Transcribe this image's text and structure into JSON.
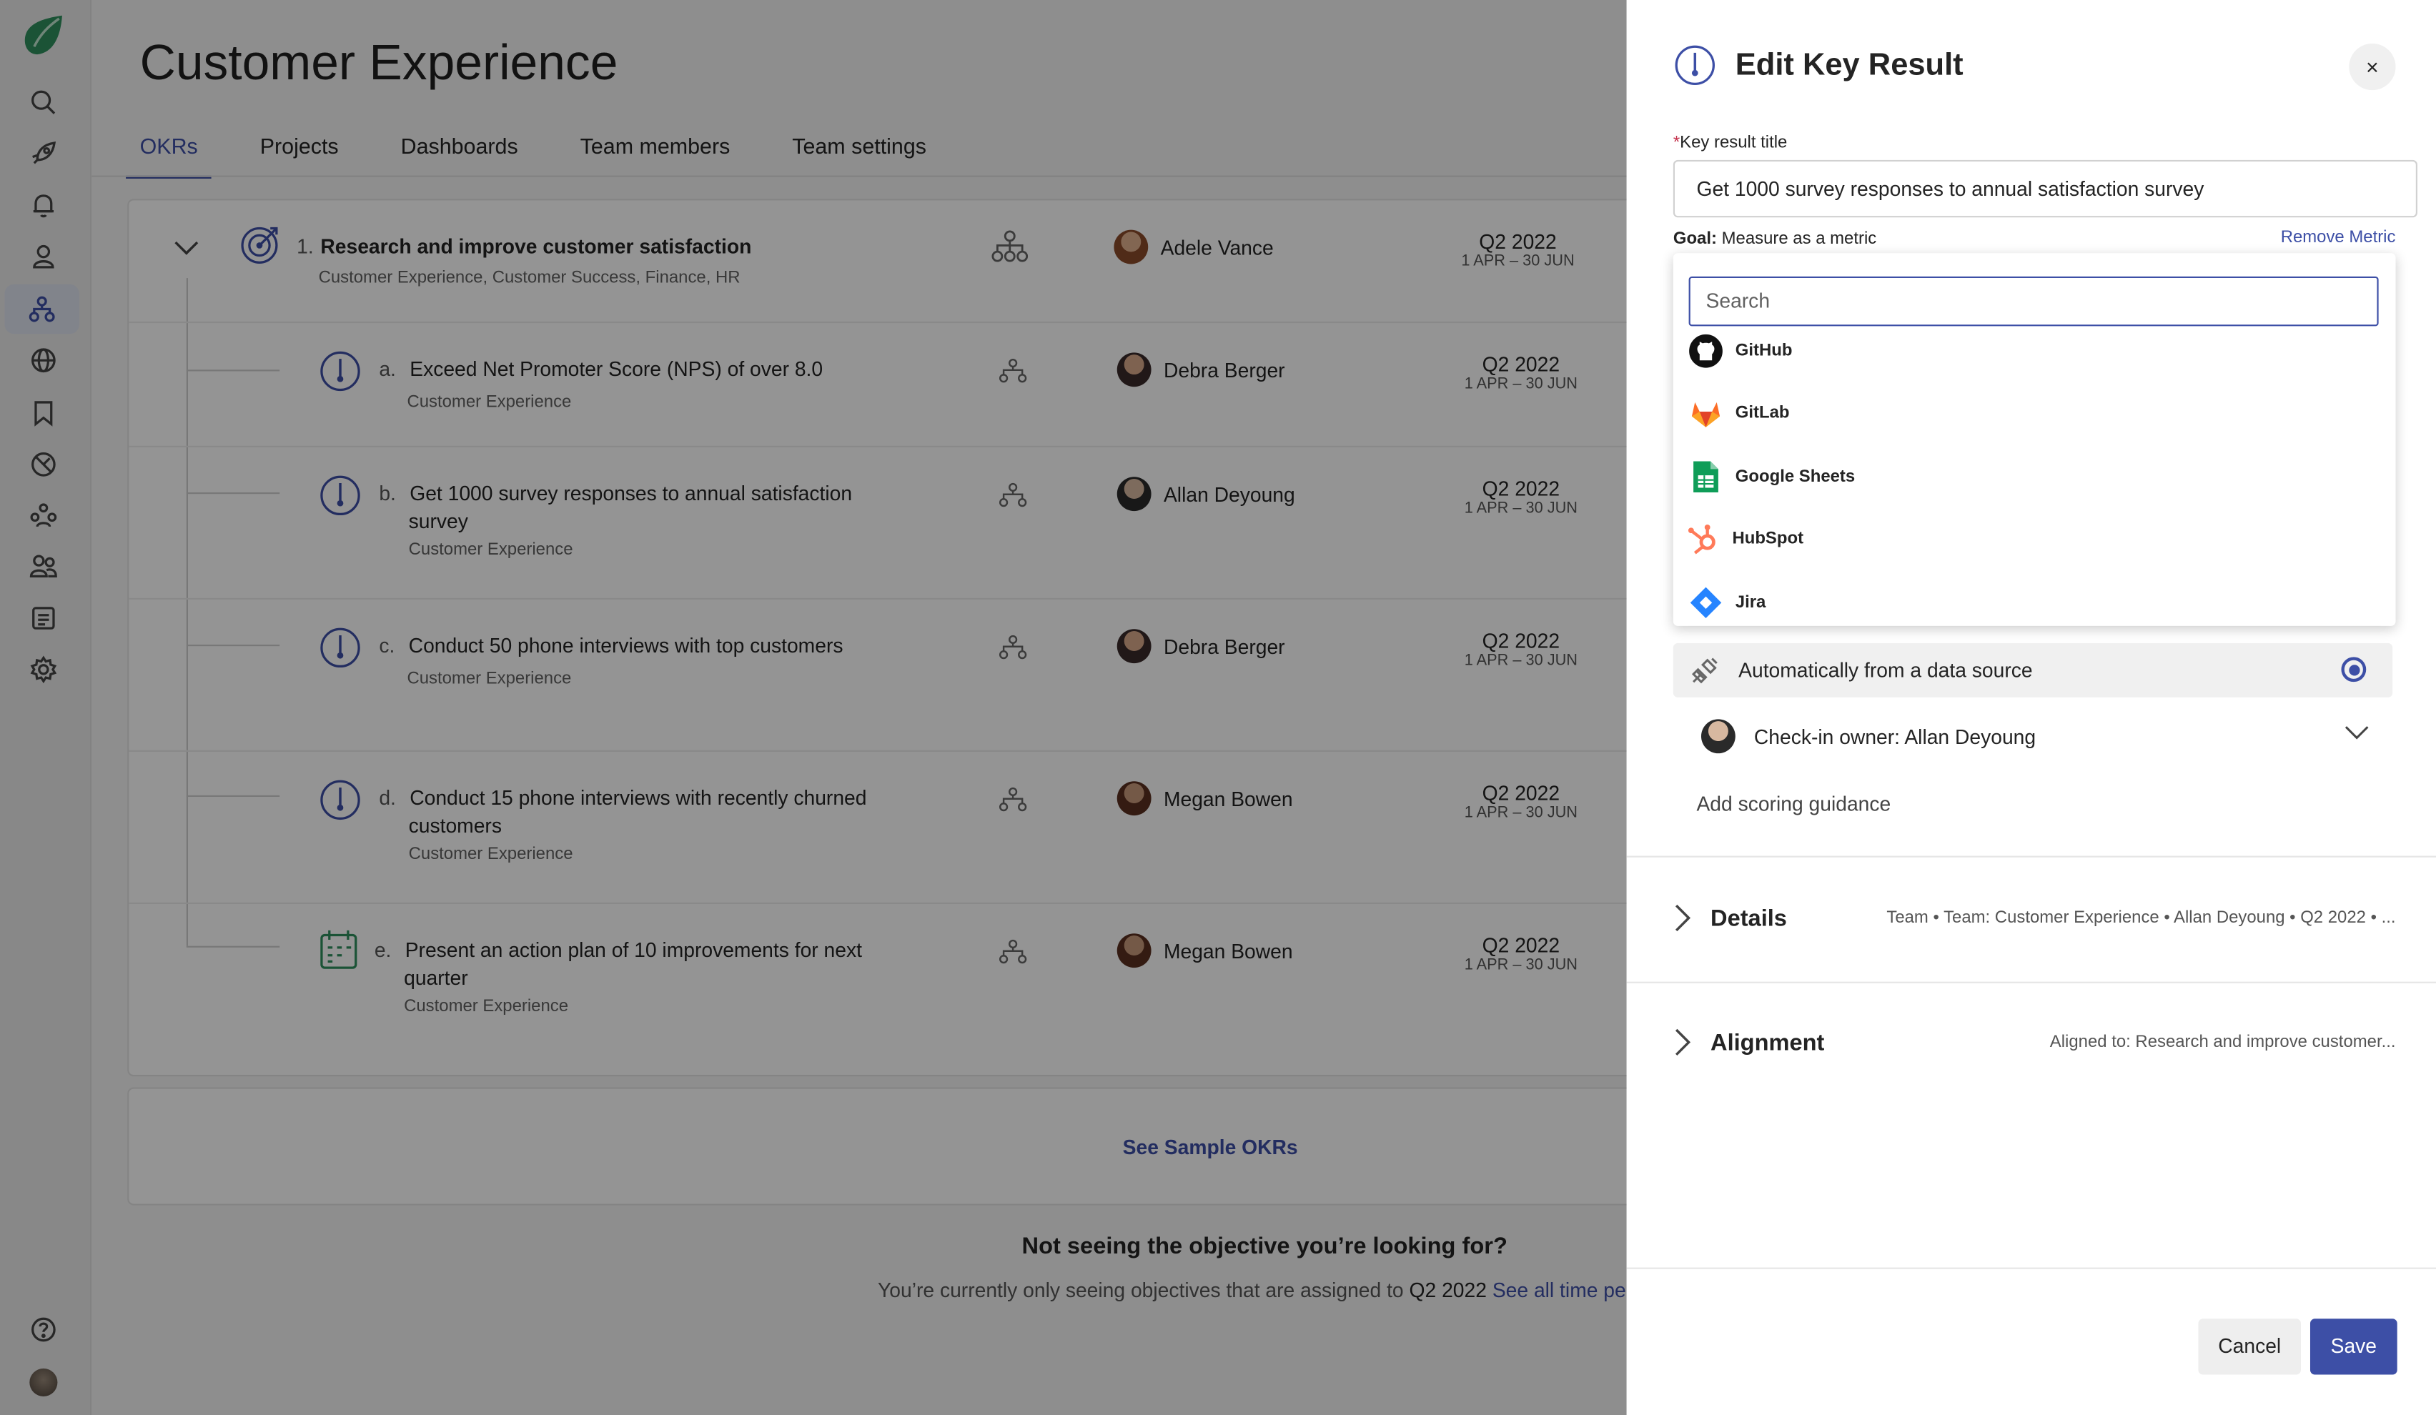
{
  "nav": {
    "items": [
      "search-icon",
      "rocket-icon",
      "bell-icon",
      "person-icon",
      "hierarchy-icon",
      "globe-icon",
      "bookmark-icon",
      "speedometer-icon",
      "people-group-icon",
      "people-icon",
      "checklist-icon",
      "gear-icon"
    ],
    "bottom": [
      "help-icon",
      "user-avatar"
    ]
  },
  "header": {
    "title": "Customer Experience",
    "tabs": [
      {
        "label": "OKRs",
        "active": true
      },
      {
        "label": "Projects"
      },
      {
        "label": "Dashboards"
      },
      {
        "label": "Team members"
      },
      {
        "label": "Team settings"
      }
    ]
  },
  "objective": {
    "number": "1.",
    "title": "Research and improve customer satisfaction",
    "teams": "Customer Experience, Customer Success, Finance, HR",
    "owner": "Adele Vance",
    "quarter": "Q2 2022",
    "dates": "1 APR – 30 JUN"
  },
  "key_results": [
    {
      "letter": "a.",
      "title_line1": "Exceed Net Promoter Score (NPS) of over 8.0",
      "title_line2": "",
      "team": "Customer Experience",
      "owner": "Debra Berger",
      "quarter": "Q2 2022",
      "dates": "1 APR – 30 JUN",
      "icon": "gauge-icon"
    },
    {
      "letter": "b.",
      "title_line1": "Get 1000 survey responses to annual satisfaction",
      "title_line2": "survey",
      "team": "Customer Experience",
      "owner": "Allan Deyoung",
      "quarter": "Q2 2022",
      "dates": "1 APR – 30 JUN",
      "icon": "gauge-icon"
    },
    {
      "letter": "c.",
      "title_line1": "Conduct 50 phone interviews with top customers",
      "title_line2": "",
      "team": "Customer Experience",
      "owner": "Debra Berger",
      "quarter": "Q2 2022",
      "dates": "1 APR – 30 JUN",
      "icon": "gauge-icon"
    },
    {
      "letter": "d.",
      "title_line1": "Conduct 15 phone interviews with recently churned",
      "title_line2": "customers",
      "team": "Customer Experience",
      "owner": "Megan Bowen",
      "quarter": "Q2 2022",
      "dates": "1 APR – 30 JUN",
      "icon": "gauge-icon"
    },
    {
      "letter": "e.",
      "title_line1": "Present an action plan of 10 improvements for next",
      "title_line2": "quarter",
      "team": "Customer Experience",
      "owner": "Megan Bowen",
      "quarter": "Q2 2022",
      "dates": "1 APR – 30 JUN",
      "icon": "calendar-icon"
    }
  ],
  "footer": {
    "sample_link": "See Sample OKRs",
    "not_seeing": "Not seeing the objective you’re looking for?",
    "currently_prefix": "You’re currently only seeing objectives that are assigned to",
    "currently_period": "Q2 2022",
    "see_all": "See all time perio"
  },
  "panel": {
    "title": "Edit Key Result",
    "close": "×",
    "title_label_req": "*",
    "title_label": "Key result title",
    "title_value": "Get 1000 survey responses to annual satisfaction survey",
    "goal_label": "Goal:",
    "goal_value": "Measure as a metric",
    "remove_metric": "Remove Metric",
    "search_placeholder": "Search",
    "sources": [
      {
        "name": "GitHub",
        "icon": "github-icon"
      },
      {
        "name": "GitLab",
        "icon": "gitlab-icon"
      },
      {
        "name": "Google Sheets",
        "icon": "google-sheets-icon"
      },
      {
        "name": "HubSpot",
        "icon": "hubspot-icon"
      },
      {
        "name": "Jira",
        "icon": "jira-icon"
      }
    ],
    "auto_source": "Automatically from a data source",
    "checkin_owner": "Check-in owner: Allan Deyoung",
    "scoring": "Add scoring guidance",
    "details_label": "Details",
    "details_summary": "Team • Team: Customer Experience • Allan Deyoung • Q2 2022 • ...",
    "alignment_label": "Alignment",
    "alignment_summary": "Aligned to: Research and improve customer...",
    "cancel": "Cancel",
    "save": "Save"
  },
  "colors": {
    "accent": "#3d4fa6",
    "logo_green": "#2f8f5e",
    "overlay": "rgba(0,0,0,0.42)"
  }
}
